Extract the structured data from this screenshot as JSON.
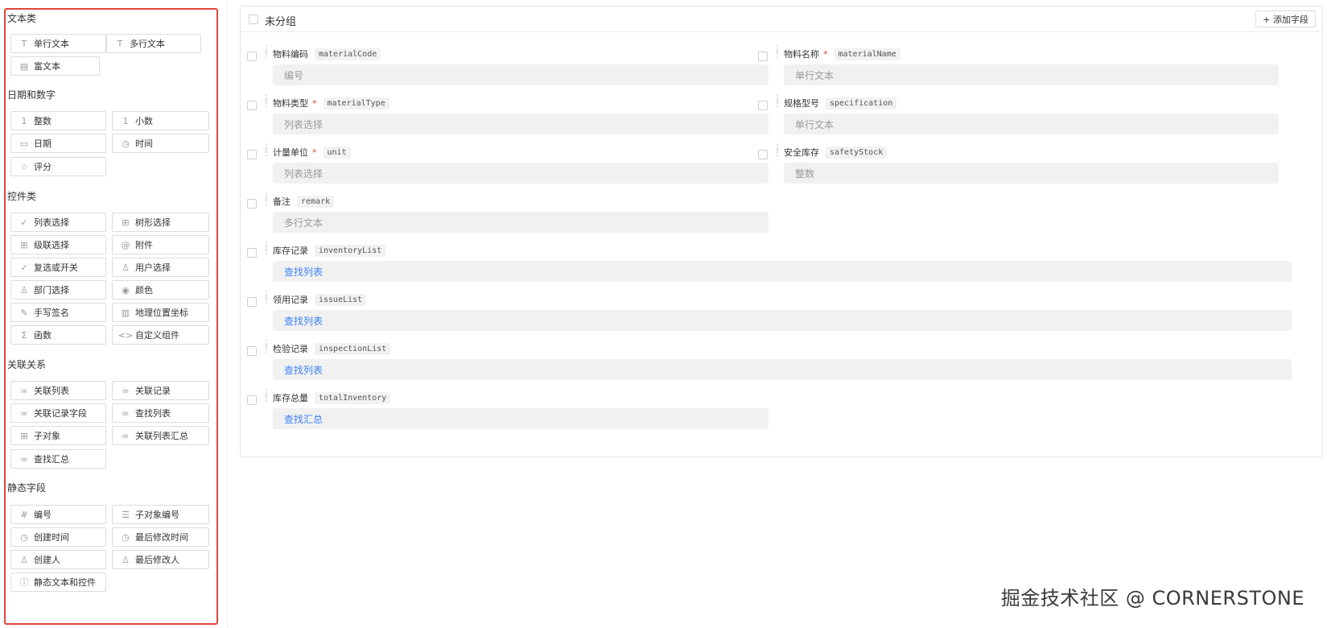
{
  "palette": {
    "sections": [
      {
        "title": "文本类",
        "items": [
          {
            "label": "单行文本",
            "icon": "T"
          },
          {
            "label": "多行文本",
            "icon": "T"
          },
          {
            "label": "富文本",
            "icon": "▤"
          }
        ]
      },
      {
        "title": "日期和数字",
        "items": [
          {
            "label": "整数",
            "icon": "1"
          },
          {
            "label": "小数",
            "icon": "1"
          },
          {
            "label": "日期",
            "icon": "▭"
          },
          {
            "label": "时间",
            "icon": "◷"
          },
          {
            "label": "评分",
            "icon": "☆"
          }
        ]
      },
      {
        "title": "控件类",
        "items": [
          {
            "label": "列表选择",
            "icon": "✓"
          },
          {
            "label": "树形选择",
            "icon": "⊞"
          },
          {
            "label": "级联选择",
            "icon": "⊞"
          },
          {
            "label": "附件",
            "icon": "@"
          },
          {
            "label": "复选或开关",
            "icon": "✓"
          },
          {
            "label": "用户选择",
            "icon": "♙"
          },
          {
            "label": "部门选择",
            "icon": "♙"
          },
          {
            "label": "颜色",
            "icon": "◉"
          },
          {
            "label": "手写签名",
            "icon": "✎"
          },
          {
            "label": "地理位置坐标",
            "icon": "▥"
          },
          {
            "label": "函数",
            "icon": "Σ"
          },
          {
            "label": "自定义组件",
            "icon": "<>"
          }
        ]
      },
      {
        "title": "关联关系",
        "items": [
          {
            "label": "关联列表",
            "icon": "∞"
          },
          {
            "label": "关联记录",
            "icon": "∞"
          },
          {
            "label": "关联记录字段",
            "icon": "∞"
          },
          {
            "label": "查找列表",
            "icon": "∞"
          },
          {
            "label": "子对象",
            "icon": "⊞"
          },
          {
            "label": "关联列表汇总",
            "icon": "∞"
          },
          {
            "label": "查找汇总",
            "icon": "∞"
          }
        ]
      },
      {
        "title": "静态字段",
        "items": [
          {
            "label": "编号",
            "icon": "#"
          },
          {
            "label": "子对象编号",
            "icon": "☰"
          },
          {
            "label": "创建时间",
            "icon": "◷"
          },
          {
            "label": "最后修改时间",
            "icon": "◷"
          },
          {
            "label": "创建人",
            "icon": "♙"
          },
          {
            "label": "最后修改人",
            "icon": "♙"
          },
          {
            "label": "静态文本和控件",
            "icon": "ⓘ"
          }
        ]
      }
    ]
  },
  "group": {
    "title": "未分组",
    "add_label": "+ 添加字段",
    "fields": [
      {
        "label": "物料编码",
        "code": "materialCode",
        "required": false,
        "placeholder": "编号"
      },
      {
        "label": "物料名称",
        "code": "materialName",
        "required": true,
        "placeholder": "单行文本"
      },
      {
        "label": "物料类型",
        "code": "materialType",
        "required": true,
        "placeholder": "列表选择"
      },
      {
        "label": "规格型号",
        "code": "specification",
        "required": false,
        "placeholder": "单行文本"
      },
      {
        "label": "计量单位",
        "code": "unit",
        "required": true,
        "placeholder": "列表选择"
      },
      {
        "label": "安全库存",
        "code": "safetyStock",
        "required": false,
        "placeholder": "整数"
      },
      {
        "label": "备注",
        "code": "remark",
        "required": false,
        "placeholder": "多行文本"
      },
      {
        "label": "库存记录",
        "code": "inventoryList",
        "required": false,
        "placeholder": "查找列表"
      },
      {
        "label": "领用记录",
        "code": "issueList",
        "required": false,
        "placeholder": "查找列表"
      },
      {
        "label": "检验记录",
        "code": "inspectionList",
        "required": false,
        "placeholder": "查找列表"
      },
      {
        "label": "库存总量",
        "code": "totalInventory",
        "required": false,
        "placeholder": "查找汇总"
      }
    ]
  },
  "required_mark": "*",
  "watermark": "掘金技术社区 @ CORNERSTONE",
  "colors": {
    "highlight_border": "#e0453c",
    "link": "#3b82f6",
    "required": "#e0453c"
  }
}
